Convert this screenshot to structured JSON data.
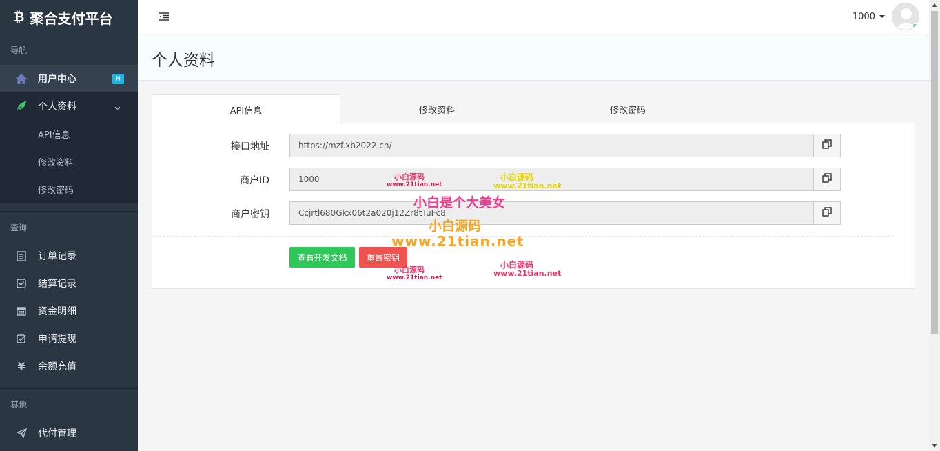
{
  "brand": {
    "icon": "bitcoin-icon",
    "title": "聚合支付平台"
  },
  "sidebar": {
    "nav_heading": "导航",
    "user_center": {
      "label": "用户中心",
      "badge": "N"
    },
    "profile": {
      "label": "个人资料",
      "submenu": [
        "API信息",
        "修改资料",
        "修改密码"
      ]
    },
    "query_heading": "查询",
    "query_items": [
      "订单记录",
      "结算记录",
      "资金明细",
      "申请提现",
      "余额充值"
    ],
    "other_heading": "其他",
    "other_items": [
      "代付管理"
    ]
  },
  "topbar": {
    "username": "1000"
  },
  "page": {
    "title": "个人资料"
  },
  "tabs": [
    "API信息",
    "修改资料",
    "修改密码"
  ],
  "form": {
    "api_url": {
      "label": "接口地址",
      "value": "https://mzf.xb2022.cn/"
    },
    "merchant_id": {
      "label": "商户ID",
      "value": "1000"
    },
    "merchant_key": {
      "label": "商户密钥",
      "value": "Ccjrtl680Gkx06t2a020j12Zr8tTuFc8"
    }
  },
  "buttons": {
    "docs": "查看开发文档",
    "reset": "重置密钥"
  },
  "watermarks": {
    "w1": "小白源码",
    "w1url": "www.21tian.net",
    "w2": "小白源码",
    "w2url": "www.21tian.net",
    "w3": "小白是个大美女",
    "w4": "小白源码",
    "w5": "www.21tian.net",
    "w6": "小白源码",
    "w6url": "www.21tian.net",
    "w7": "小白源码",
    "w7url": "www.21tian.net"
  },
  "colors": {
    "sidebar": "#2b3643",
    "success": "#2fc65a",
    "danger": "#ef5350",
    "badge": "#1fb5e0"
  }
}
